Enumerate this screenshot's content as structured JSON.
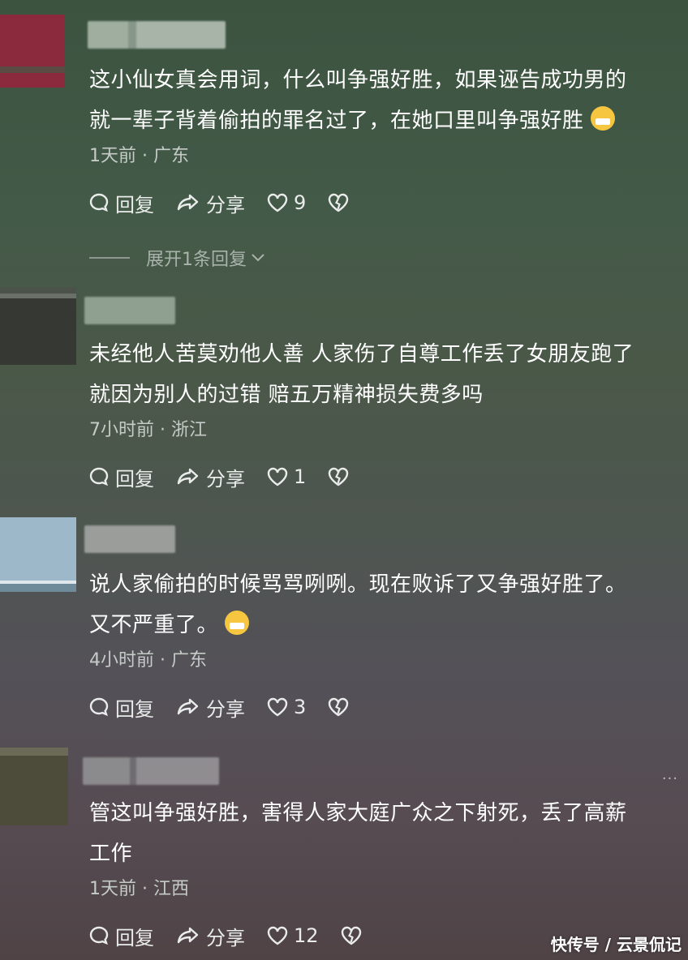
{
  "comments": [
    {
      "text_line1": "这小仙女真会用词，什么叫争强好胜，如果诬告成功男的",
      "text_line2": "就一辈子背着偷拍的罪名过了，在她口里叫争强好胜",
      "emoji": "grimacing-sweat-emoji",
      "time": "1天前",
      "dot": "·",
      "location": "广东",
      "reply_label": "回复",
      "share_label": "分享",
      "likes": "9",
      "expand_label": "展开1条回复"
    },
    {
      "text_line1": "未经他人苦莫劝他人善 人家伤了自尊工作丢了女朋友跑了",
      "text_line2": "就因为别人的过错 赔五万精神损失费多吗",
      "time": "7小时前",
      "dot": "·",
      "location": "浙江",
      "reply_label": "回复",
      "share_label": "分享",
      "likes": "1"
    },
    {
      "text_line1": "说人家偷拍的时候骂骂咧咧。现在败诉了又争强好胜了。",
      "text_line2": "又不严重了。",
      "emoji": "laughing-tears-emoji",
      "time": "4小时前",
      "dot": "·",
      "location": "广东",
      "reply_label": "回复",
      "share_label": "分享",
      "likes": "3"
    },
    {
      "text_line1": "管这叫争强好胜，害得人家大庭广众之下射死，丢了高薪",
      "text_line2": "工作",
      "time": "1天前",
      "dot": "·",
      "location": "江西",
      "reply_label": "回复",
      "share_label": "分享",
      "likes": "12",
      "more_label": "···"
    }
  ],
  "watermark": "快传号 / 云景侃记",
  "colors": {
    "avatar1": "#8b2a3c",
    "avatar2": "#353833",
    "avatar3": "#9db8c8",
    "avatar4": "#4d4c3a"
  }
}
